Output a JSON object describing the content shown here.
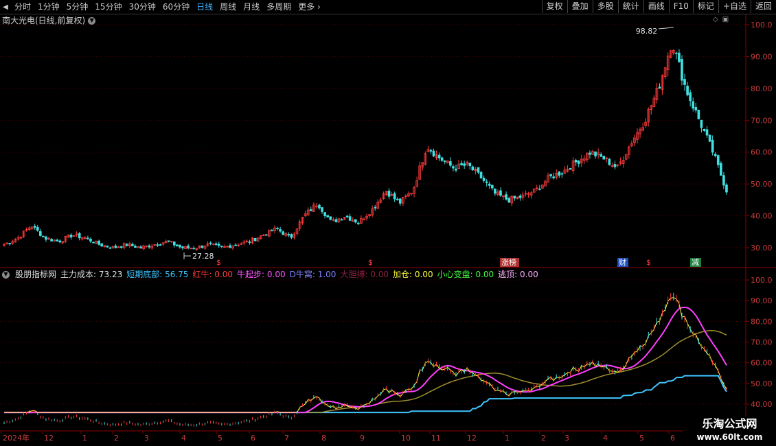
{
  "toolbar": {
    "periods": [
      {
        "label": "分时",
        "active": false
      },
      {
        "label": "1分钟",
        "active": false
      },
      {
        "label": "5分钟",
        "active": false
      },
      {
        "label": "15分钟",
        "active": false
      },
      {
        "label": "30分钟",
        "active": false
      },
      {
        "label": "60分钟",
        "active": false
      },
      {
        "label": "日线",
        "active": true
      },
      {
        "label": "周线",
        "active": false
      },
      {
        "label": "月线",
        "active": false
      },
      {
        "label": "多周期",
        "active": false
      }
    ],
    "more_label": "更多",
    "more_arrow": "›",
    "right_buttons": [
      "复权",
      "叠加",
      "多股",
      "统计",
      "画线",
      "F10",
      "标记",
      "+自选",
      "返回"
    ]
  },
  "main_panel": {
    "title": "南大光电(日线,前复权)",
    "high_label": "98.82",
    "low_label": "27.28",
    "y_labels": [
      "100.0",
      "90.00",
      "80.00",
      "70.00",
      "60.00",
      "50.00",
      "40.00",
      "30.00"
    ],
    "event_marks": [
      {
        "text": "$",
        "color": "#ff3c3c"
      },
      {
        "text": "$",
        "color": "#ff3c3c"
      },
      {
        "text": "涨榜",
        "color": "#ffffff",
        "bg": "#b03030"
      },
      {
        "text": "财",
        "color": "#ffffff",
        "bg": "#2050c0"
      },
      {
        "text": "$",
        "color": "#ff3c3c"
      },
      {
        "text": "减",
        "color": "#ffffff",
        "bg": "#208040"
      }
    ]
  },
  "indicator_panel": {
    "name": "股朋指标网",
    "items": [
      {
        "label": "主力成本: 73.23",
        "color": "#e0e0e0"
      },
      {
        "label": "短期底部: 56.75",
        "color": "#3fc6ff"
      },
      {
        "label": "红牛: 0.00",
        "color": "#ff3c3c"
      },
      {
        "label": "牛起步: 0.00",
        "color": "#ff55ff"
      },
      {
        "label": "D牛窝: 1.00",
        "color": "#8080ff"
      },
      {
        "label": "大胆搏: 0.00",
        "color": "#8b2040"
      },
      {
        "label": "加仓: 0.00",
        "color": "#ffff40"
      },
      {
        "label": "小心变盘: 0.00",
        "color": "#40ff40"
      },
      {
        "label": "逃顶: 0.00",
        "color": "#ffb0ff"
      }
    ],
    "y_labels": [
      "100.0",
      "90.00",
      "80.00",
      "70.00",
      "60.00",
      "50.00",
      "40.00"
    ]
  },
  "x_axis": {
    "labels": [
      "2024年",
      "12",
      "1",
      "2",
      "3",
      "4",
      "5",
      "6",
      "7",
      "8",
      "9",
      "10",
      "11",
      "12",
      "1",
      "2",
      "3",
      "4",
      "5",
      "6"
    ]
  },
  "watermark": {
    "line1": "乐淘公式网",
    "line2": "www.60lt.com"
  },
  "chart_data": {
    "type": "candlestick",
    "title": "南大光电(日线,前复权)",
    "price_ylim": [
      25,
      102
    ],
    "indicator_ylim": [
      34,
      102
    ],
    "highest": 98.82,
    "lowest": 27.28,
    "series_keypoints": {
      "close": [
        31,
        33,
        37,
        33,
        32,
        34,
        33,
        31,
        30,
        31,
        30,
        31,
        32,
        30,
        30,
        31,
        30,
        31,
        32,
        34,
        36,
        33,
        40,
        44,
        38,
        40,
        38,
        42,
        48,
        44,
        48,
        62,
        58,
        55,
        56,
        52,
        47,
        45,
        46,
        48,
        52,
        54,
        57,
        60,
        58,
        55,
        63,
        70,
        80,
        95,
        80,
        70,
        60,
        48
      ]
    }
  }
}
